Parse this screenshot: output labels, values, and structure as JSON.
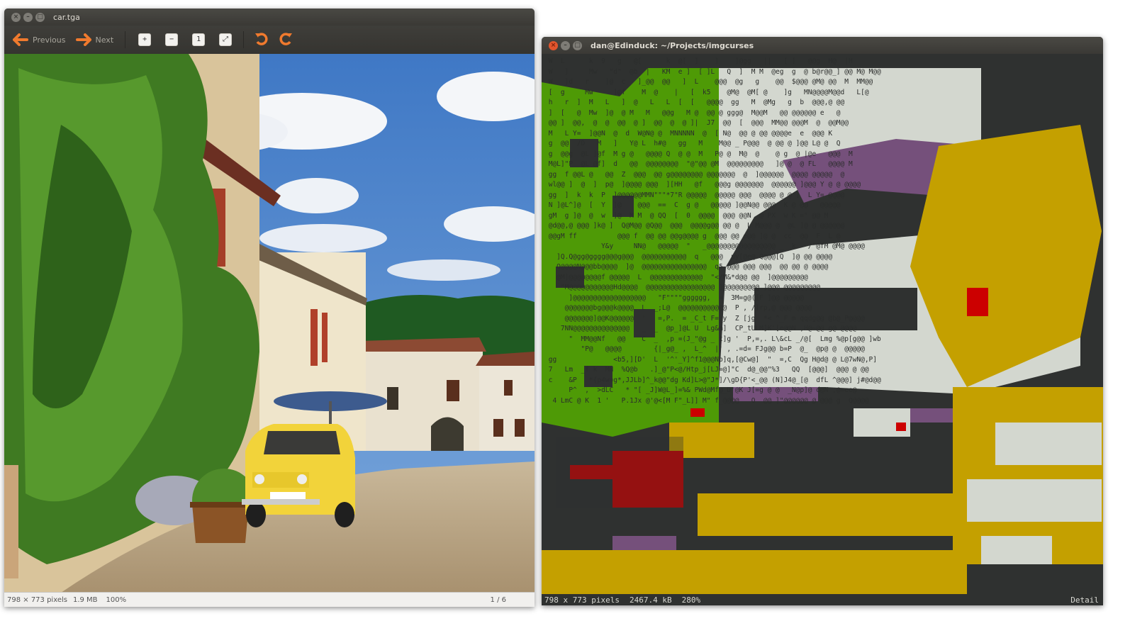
{
  "viewer": {
    "title": "car.tga",
    "previous_label": "Previous",
    "next_label": "Next",
    "status": {
      "dimensions": "798 × 773 pixels",
      "size": "1.9 MB",
      "zoom": "100%",
      "page": "1 / 6"
    }
  },
  "terminal": {
    "title": "dan@Edinduck: ~/Projects/imgcurses",
    "status": {
      "dimensions": "798 x 773 pixels",
      "size": "2467.4 kB",
      "zoom": "280%",
      "mode": "Detail"
    },
    "glyph_rows": [
      " W  L      k  9   g   @[      k  @[  ]    ]    ]@gg   ||   [ ]   @@g  H@  |H   ",
      " W   ]     Mw   \"d\"  @b  |   KM  e ]  [ ]L   Q  ]  M M  @eg  g  @ b@r@@_] @@ M@ M@@ ",
      " W   ]d   r    ]@  c   ]_@@  @@   ]  L    @@@  @g   g    @@  $@@@ @M@ @@  M  MM@@ ",
      " [  g     Mw     ]@f    M  @    |   [  k5    @M@  @M[ @    ]g   MN@@@@M@@d   L[@ ",
      " h   r  ]  M   L   ]  @   L   L  [  [   @@@@  gg   M  @Mg   g  b  @@@,@ @@    ",
      " ]  [   @  Mw  ]@  @ M   M   @@g   M @  @@ @ ggg@  M@@M   @@ @@@@@@ e   @    ",
      " @@ ]  @@,  @  @  @@  @ ]  @@  @  @ ]|  J7  @@  [  @@@  MM@@ @@@M  @  @@M@@ ",
      " M   L Y=  ]@@N  @  d  W@N@ @  MNNNNN  @  [ N@  @@ @ @@ @@@@e  e  @@@ K  ",
      " g  @@  /D   M   ]   Y@ L  h#@   gg   M    M@@ _ P@@@  @ @@ @ ]@@ L@ @  Q   ",
      " g  @@g  @L ]@f  M g @   @@@@ Q  @ @  M   P@ @  M@  @    @ g  @ |@e   @@@  M   ",
      " M@L]\"P  @L @f]  d   @@  @@@@@@@@  \"@\"@@ @M  @@@@@@@@@   ]@ @  @ FL   @@@@ M  ",
      " gg  f @@L @   @@  Z  @@@  @@ g@@@@@@@@ @@@@@@@  @  ]@@@@@@  @@@@ @@@@@  @ ",
      " wl@@ ]  @  ]  p@  ]@@@@ @@@  ][HH   @f   @@@g @@@@@@@  @@@@@@ ]@@@ Y @ @ @@@@",
      " gg  ]  k  k  P  ]@@@@@@MMN\"\"\"*7\"R @@@@@  @@@@@ @@@  @@@@ @ @ ]  L Y= @@@@ ",
      " N ]@L^]@  [  Y  ]@    @@@  ==  C  g @   @@@@@ ]@@N@@ @@@  K @ @@   @@@@@ ",
      " gM  g ]@  @  w  ]@  M M  @ QQ  [  0  @@@@  @@@ @@N  @ PX  w K =\" @@ M ",
      " @d@@,@ @@@ ]k@ ]  Q@M@@ @Q@@  @@@  @@@@g@@ @@ @  L M@@@ @  @L ]@ @ @@@@@@ ",
      " @@gM ff          @@@ f  @@ @@ @@g@@@@ g  @@@ @@ e@@ ]@ @  cc  @@  F  L @ ",
      "              Y&y     NN@   @@@@@  \"   _@@@@@@@@@@@@@@@@@ _  k   /\"@fM @M@ @@@@ ",
      "   ]Q.Q@gg@gggg@@@g@@@  @@@@@@@@@@@  q   @@@  py[@e@ Q@@@[Q  ]@ @@ @@@@ ",
      "   Q@@@@N@@@bb@@@@  ]@  @@@@@@@@@@@@@@@@  q5 @@@ @@@ @@@  @@ @@ @ @@@@ ",
      "   @M]@@@@@@@@f @@@@@  L  @@@@@@@@@@@@@  \"</M&*d@@ @@  ]@@@@@@@@@ ",
      "    \"M@@@@@@@@@@@Hd@@@@  @@@@@@@@@@@@@@@@@ ]@@@@@@@@@ ]@@@ @@@@@@@@@ ",
      "      ]@@@@@@@@@@@@@@@@@@   \"F\"\"\"\"gggggg,  =  3M=g@([F ]@@ @@@@@ ",
      "     @@@@@@@bg@@@k@@@@  L  _;L@  @@@@@@@@@@@@  P , /]rp,@ @@@ @@@@ ",
      "     @@@@@@@]@@K@@@@@@  '   =,P.  = _C_t F=_y  Z [jg  *< ^_F m qqdg@@ @b@_P@@@@ ",
      "    7NN@@@@@@@@@@@@@@   _  _  @p_]@L U  Lg&m]  CP_tULM]K'[e@@N ,H@~@@ g@ @@@@ ",
      "      \"  MM@@Nf   @@    C  _  ,p =(J_\"@g _ t]g '  P,=,. L\\&cL _/@[  Lmg %@p[g@@ ]wb   ",
      "         \"P@   @@@@        {|_g@_ ,  L_^  |' , .=d= FJg@@ b=P  @_  @p@ @  @@@@@ ",
      " gg              <b5,][D'  L  '^'_Y]^f1@@@Nb]q,[@Cw@]  \"  =,C  Qg H@d@ @ L@7wN@,P] ",
      " 7   Lm  _f k  MN  %Q@b   .]_@\"P<@/Htp_j[LJ=@]\"C  d@_@@\"%3   QQ  [@@@]  @@@ @ @@ ",
      " c    &P   *{p4w=g*,JJLb]^_k@@\"dg Kd]L>@\"J*]/\\gD{P'<_@@ (N]J4@_[@  dfL ^@@@] j#@d@@ ",
      "      P^  ,  >dLC   * \"[ _J]W@L_]=%& PWd@Mf@_D'@K J[=g @ @  _N@p]@ d@N ,@=ee@ ",
      "  4 LmC @ K  1 '   P.1Jx @'@<[M F\"_L]] M\" f_@@@@   Q  @@ ]\"@@@@@@ @ @@@ g  Q@@@@ "
    ]
  }
}
